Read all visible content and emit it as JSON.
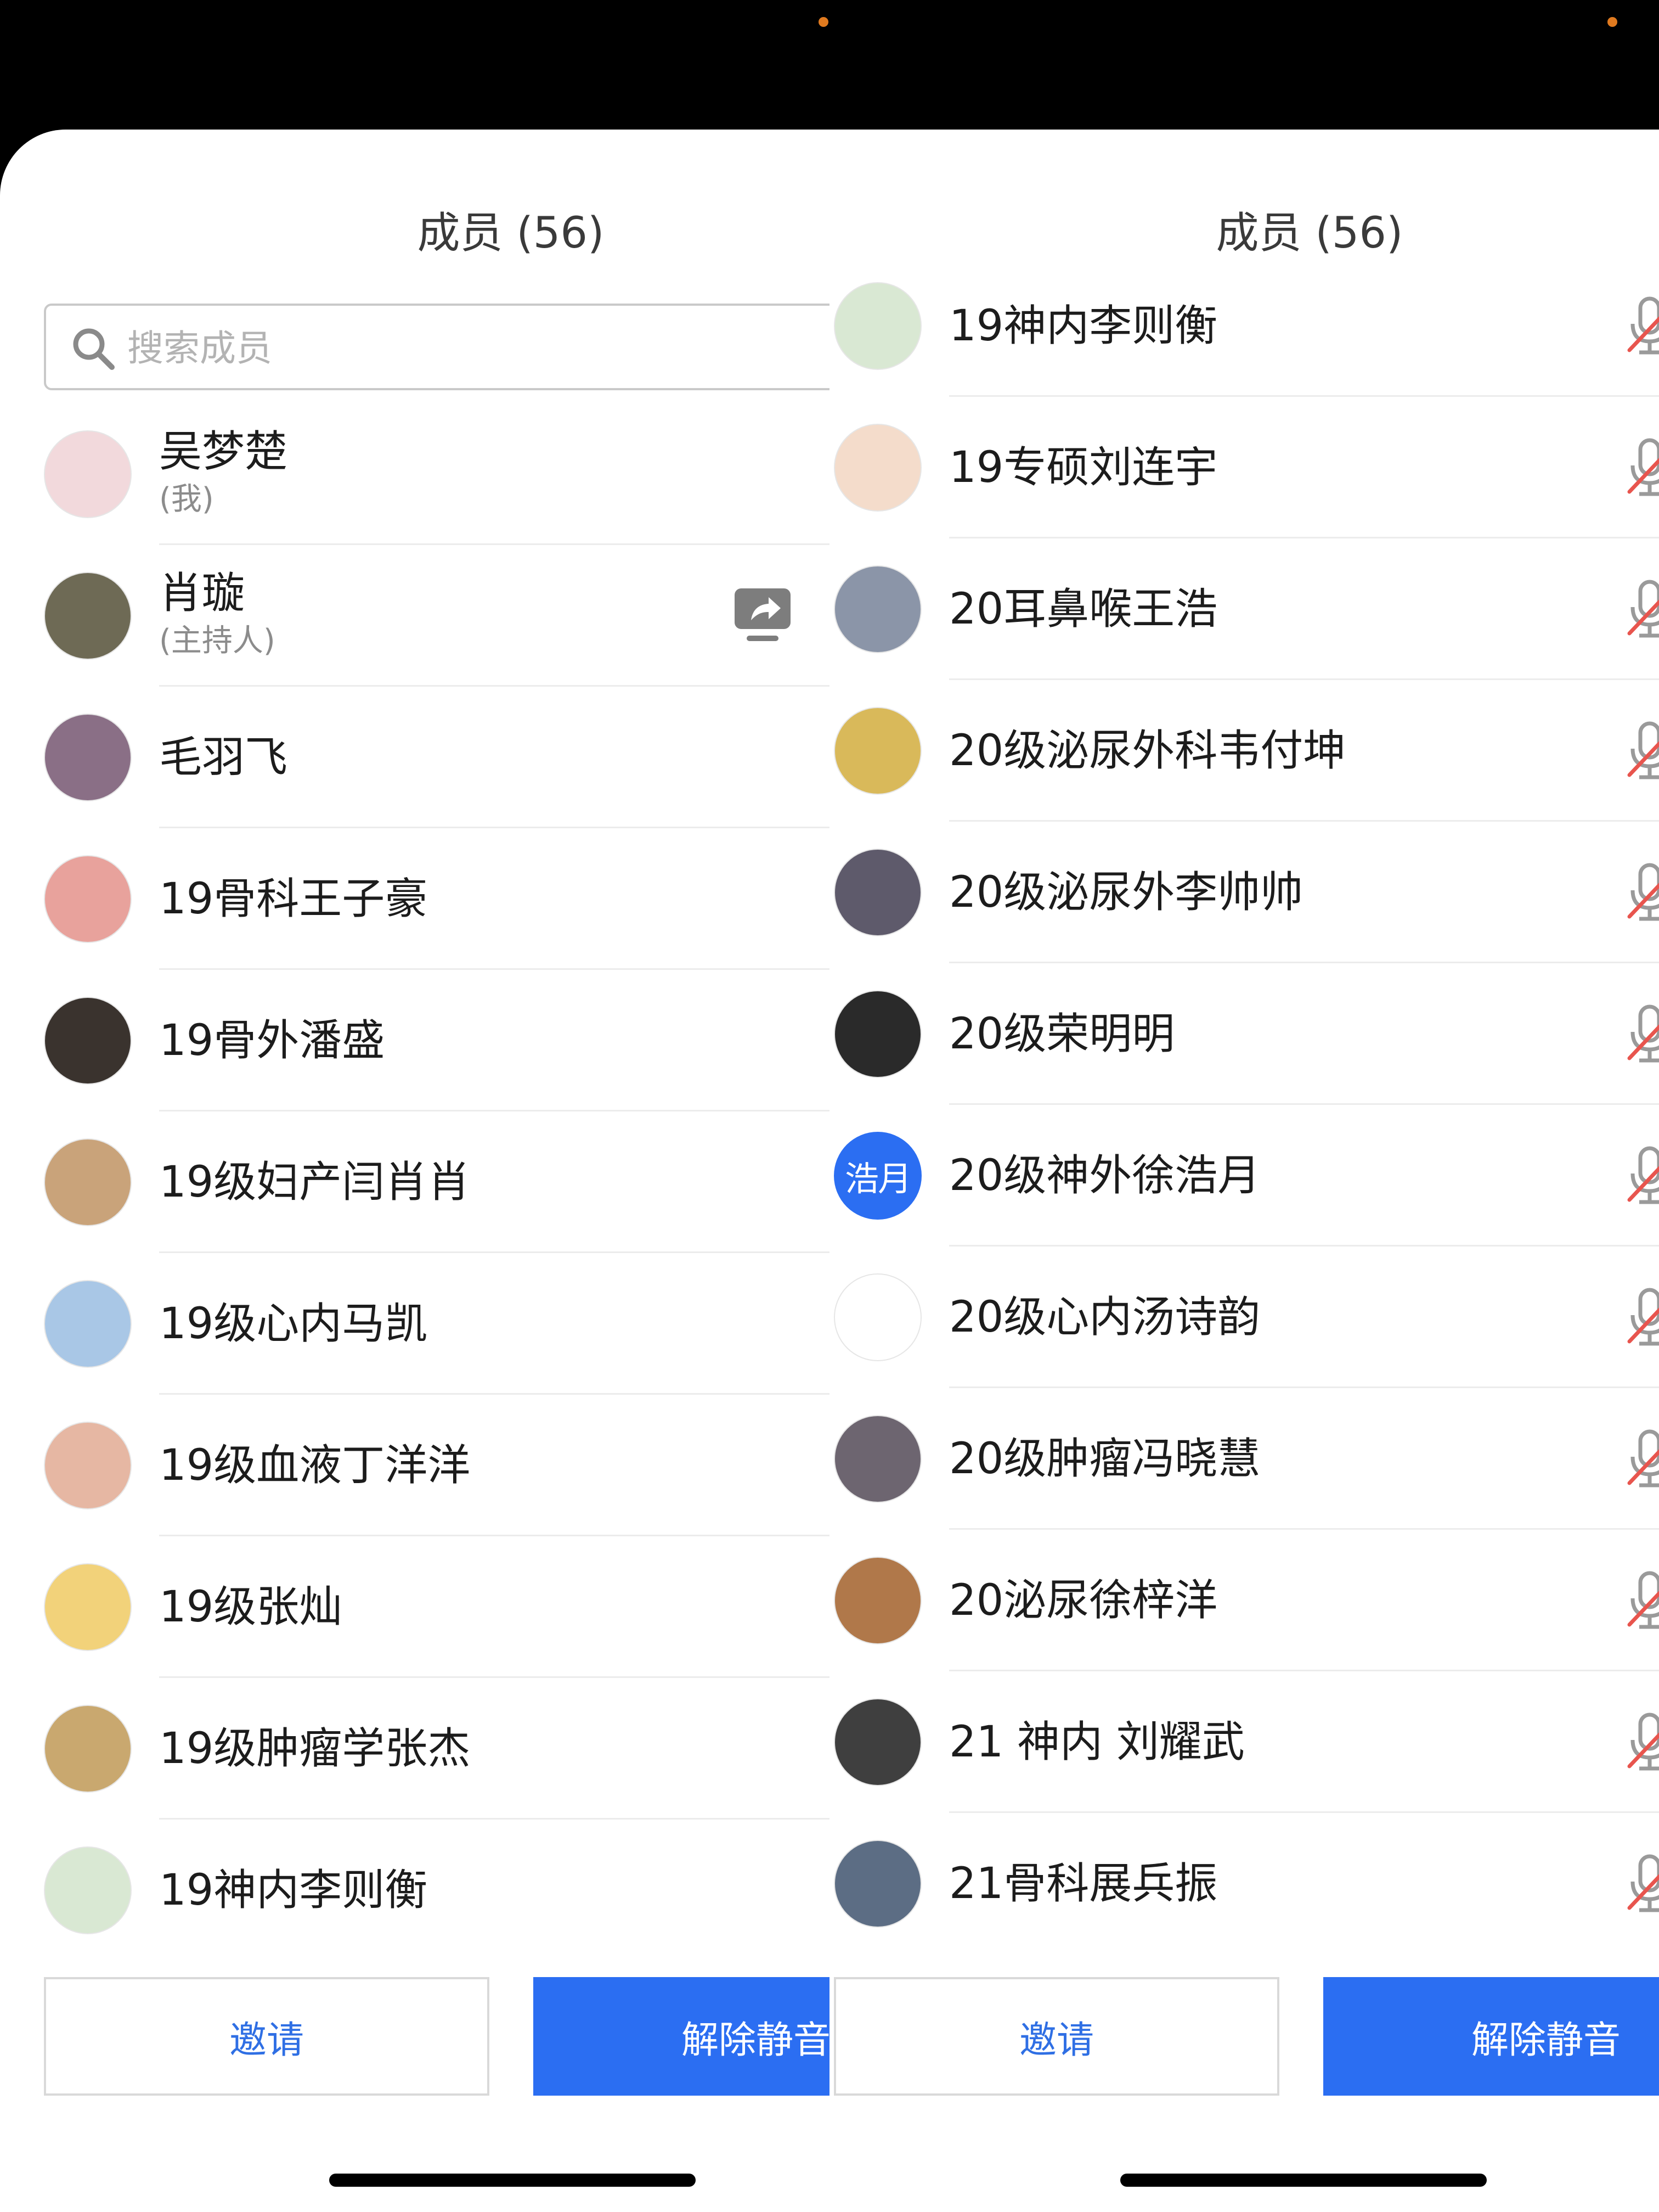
{
  "header": {
    "title": "成员 (56)"
  },
  "search": {
    "placeholder": "搜索成员"
  },
  "buttons": {
    "invite": "邀请",
    "unmute": "解除静音"
  },
  "left_members": [
    {
      "name": "吴梦楚",
      "sub": "(我)",
      "avatar_color": "#f2d9dc"
    },
    {
      "name": "肖璇",
      "sub": "(主持人)",
      "avatar_color": "#6e6a55",
      "sharing": true
    },
    {
      "name": "毛羽飞",
      "avatar_color": "#8a6f86"
    },
    {
      "name": "19骨科王子豪",
      "avatar_color": "#e8a29c"
    },
    {
      "name": "19骨外潘盛",
      "avatar_color": "#3a332e"
    },
    {
      "name": "19级妇产闫肖肖",
      "avatar_color": "#c9a37a"
    },
    {
      "name": "19级心内马凯",
      "avatar_color": "#a9c7e6"
    },
    {
      "name": "19级血液丁洋洋",
      "avatar_color": "#e6b7a3"
    },
    {
      "name": "19级张灿",
      "avatar_color": "#f2d27a"
    },
    {
      "name": "19级肿瘤学张杰",
      "avatar_color": "#c9a86f"
    },
    {
      "name": "19神内李则衡",
      "avatar_color": "#d9e8d3"
    }
  ],
  "right_members": [
    {
      "name": "19神内李则衡",
      "avatar_color": "#d9e8d3",
      "muted": true
    },
    {
      "name": "19专硕刘连宇",
      "avatar_color": "#f4dccb",
      "muted": true
    },
    {
      "name": "20耳鼻喉王浩",
      "avatar_color": "#8b95a8",
      "muted": true
    },
    {
      "name": "20级泌尿外科韦付坤",
      "avatar_color": "#d9b95a",
      "muted": true
    },
    {
      "name": "20级泌尿外李帅帅",
      "avatar_color": "#5e5a6b",
      "muted": true
    },
    {
      "name": "20级荣明明",
      "avatar_color": "#2a2a2a",
      "muted": true
    },
    {
      "name": "20级神外徐浩月",
      "avatar_text": "浩月",
      "avatar_color": "#2b6ef2",
      "muted": true
    },
    {
      "name": "20级心内汤诗韵",
      "avatar_color": "#ffffff",
      "muted": true
    },
    {
      "name": "20级肿瘤冯晓慧",
      "avatar_color": "#6d6570",
      "muted": true
    },
    {
      "name": "20泌尿徐梓洋",
      "avatar_color": "#b0784a",
      "muted": true
    },
    {
      "name": "21 神内 刘耀武",
      "avatar_color": "#3f3f3f",
      "muted": true
    },
    {
      "name": "21骨科展兵振",
      "avatar_color": "#5c6d84",
      "muted": true
    }
  ],
  "colors": {
    "accent": "#2b6ef2",
    "mute_slash": "#e8554e"
  },
  "icons": [
    "search-icon",
    "share-screen-icon",
    "mic-muted-icon"
  ]
}
